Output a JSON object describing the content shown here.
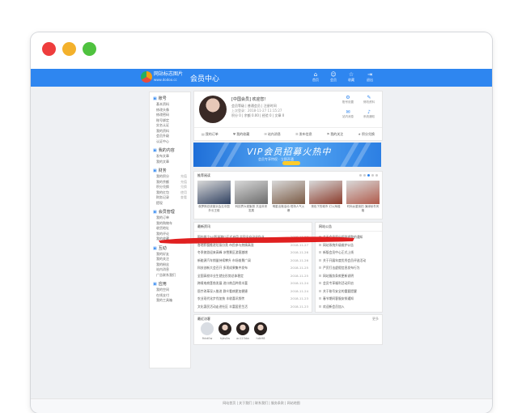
{
  "navbar": {
    "site_name": "网站标志图片",
    "site_sub": "www.dodoo.cc",
    "page_title": "会员中心",
    "icons": [
      {
        "name": "home-icon",
        "glyph": "⌂",
        "label": "首页"
      },
      {
        "name": "user-icon",
        "glyph": "☺",
        "label": "会员"
      },
      {
        "name": "star-icon",
        "glyph": "☆",
        "label": "收藏"
      },
      {
        "name": "exit-icon",
        "glyph": "⇥",
        "label": "退出"
      }
    ]
  },
  "sidebar": {
    "groups": [
      {
        "title": "账号",
        "items": [
          {
            "label": "基本资料",
            "tag": ""
          },
          {
            "label": "修改头像",
            "tag": ""
          },
          {
            "label": "修改密码",
            "tag": ""
          },
          {
            "label": "账号绑定",
            "tag": ""
          },
          {
            "label": "实名认证",
            "tag": ""
          },
          {
            "label": "我的资料",
            "tag": ""
          },
          {
            "label": "会员升级",
            "tag": ""
          },
          {
            "label": "认证中心",
            "tag": ""
          }
        ]
      },
      {
        "title": "我的内容",
        "items": [
          {
            "label": "发布文章",
            "tag": ""
          },
          {
            "label": "我的文章",
            "tag": ""
          }
        ]
      },
      {
        "title": "财务",
        "items": [
          {
            "label": "我的积分",
            "tag": "充值"
          },
          {
            "label": "我的余额",
            "tag": "充值"
          },
          {
            "label": "积分兑换",
            "tag": "兑换"
          },
          {
            "label": "我的红包",
            "tag": "使用"
          },
          {
            "label": "财务记录",
            "tag": "查看"
          },
          {
            "label": "提现",
            "tag": ""
          }
        ]
      },
      {
        "title": "会员管理",
        "items": [
          {
            "label": "我的订单",
            "tag": ""
          },
          {
            "label": "我的购物车",
            "tag": ""
          },
          {
            "label": "收货地址",
            "tag": ""
          },
          {
            "label": "我的评论",
            "tag": ""
          },
          {
            "label": "我的收藏",
            "tag": ""
          }
        ]
      },
      {
        "title": "互动",
        "items": [
          {
            "label": "我的好友",
            "tag": ""
          },
          {
            "label": "我的关注",
            "tag": ""
          },
          {
            "label": "我的粉丝",
            "tag": ""
          },
          {
            "label": "站内消息",
            "tag": ""
          },
          {
            "label": "广告联系我们",
            "tag": ""
          }
        ]
      },
      {
        "title": "应用",
        "items": [
          {
            "label": "我的空间",
            "tag": ""
          },
          {
            "label": "在线支付",
            "tag": ""
          },
          {
            "label": "我的工具箱",
            "tag": ""
          }
        ]
      }
    ]
  },
  "profile": {
    "name": "[中国会员] 欢迎您！",
    "info": "会员等级 | 普通会员 | 注册时间",
    "login": "上次登录：2018-11-27 11:15:27",
    "stats": "积分 0 | 余额 0.00 | 经验 0 | 文章 0",
    "actions": [
      {
        "name": "settings-icon",
        "glyph": "⚙",
        "label": "账号设置"
      },
      {
        "name": "edit-icon",
        "glyph": "✎",
        "label": "修改资料"
      },
      {
        "name": "message-icon",
        "glyph": "✉",
        "label": "站内消息"
      },
      {
        "name": "bell-icon",
        "glyph": "♪",
        "label": "系统通知"
      }
    ],
    "tabs": [
      {
        "icon": "▤",
        "label": "我的订单"
      },
      {
        "icon": "♥",
        "label": "我的收藏"
      },
      {
        "icon": "✉",
        "label": "站内消息"
      },
      {
        "icon": "☰",
        "label": "发布信息"
      },
      {
        "icon": "⚑",
        "label": "我的关注"
      },
      {
        "icon": "★",
        "label": "积分兑换"
      }
    ]
  },
  "banner": {
    "title": "VIP会员招募火热中",
    "subtitle": "会员专享特权 · 立即开通"
  },
  "recommend": {
    "title": "推荐阅读",
    "items": [
      {
        "caption": "俄罗斯总统普京会见中国外长王毅",
        "color": "#2f4060"
      },
      {
        "caption": "科技界大佬聚首 共话未来发展",
        "color": "#6b6b6b"
      },
      {
        "caption": "明星出席活动 现场人气火爆",
        "color": "#7a5a44"
      },
      {
        "caption": "夜色下的城市 灯火辉煌",
        "color": "#8a3a2a"
      },
      {
        "caption": "时尚女星街拍 演绎秋冬风格",
        "color": "#b05a4a"
      }
    ]
  },
  "news": {
    "title": "最新资讯",
    "rows": [
      {
        "title": "国内首个5G智慧港口正式启用 实现全自动化作业",
        "date": "2018-11-27"
      },
      {
        "title": "各地积极推进垃圾分类 市民参与热情高涨",
        "date": "2018-11-27"
      },
      {
        "title": "冬季旅游迎来高峰 冰雪景区游客激增",
        "date": "2018-11-26"
      },
      {
        "title": "新能源汽车销量持续攀升 市场前景广阔",
        "date": "2018-11-26"
      },
      {
        "title": "科技创新大会召开 多项成果集中发布",
        "date": "2018-11-25"
      },
      {
        "title": "全国高校毕业生就业形势总体稳定",
        "date": "2018-11-25"
      },
      {
        "title": "跨境电商蓬勃发展 进口商品种类丰富",
        "date": "2018-11-24"
      },
      {
        "title": "医疗改革深入推进 群众看病更加便捷",
        "date": "2018-11-24"
      },
      {
        "title": "农业现代化步伐加快 丰收喜讯频传",
        "date": "2018-11-23"
      },
      {
        "title": "文化惠民活动走进社区 丰富居民生活",
        "date": "2018-11-23"
      }
    ]
  },
  "notice": {
    "title": "网站公告",
    "rows": [
      "关于会员积分规则调整的通知",
      "网站系统升级维护公告",
      "新版会员中心正式上线",
      "关于开展年度优秀会员评选活动",
      "严厉打击虚假信息发布行为",
      "网站服务条款更新说明",
      "会员专享福利活动开启",
      "关于账号安全的重要提醒",
      "春节期间客服安排通知",
      "欢迎新会员加入"
    ]
  },
  "visitors": {
    "title": "最近访客",
    "more": "更多",
    "items": [
      {
        "name": "fhkd0w"
      },
      {
        "name": "hjds0w"
      },
      {
        "name": "ac123dw"
      },
      {
        "name": "hdk98"
      }
    ]
  },
  "footer": {
    "text": "网站首页 | 关于我们 | 联系我们 | 服务条款 | 网站地图"
  },
  "colors": {
    "brand": "#2e86f0",
    "redacted": "#e02020"
  }
}
